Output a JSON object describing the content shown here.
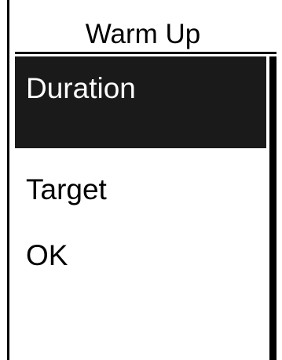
{
  "screen": {
    "title": "Warm Up"
  },
  "menu": {
    "items": [
      {
        "label": "Duration",
        "selected": true
      },
      {
        "label": "Target",
        "selected": false
      },
      {
        "label": "OK",
        "selected": false
      }
    ]
  },
  "colors": {
    "background": "#ffffff",
    "foreground": "#000000",
    "selected_background": "#1a1a1a",
    "selected_text": "#ffffff"
  }
}
